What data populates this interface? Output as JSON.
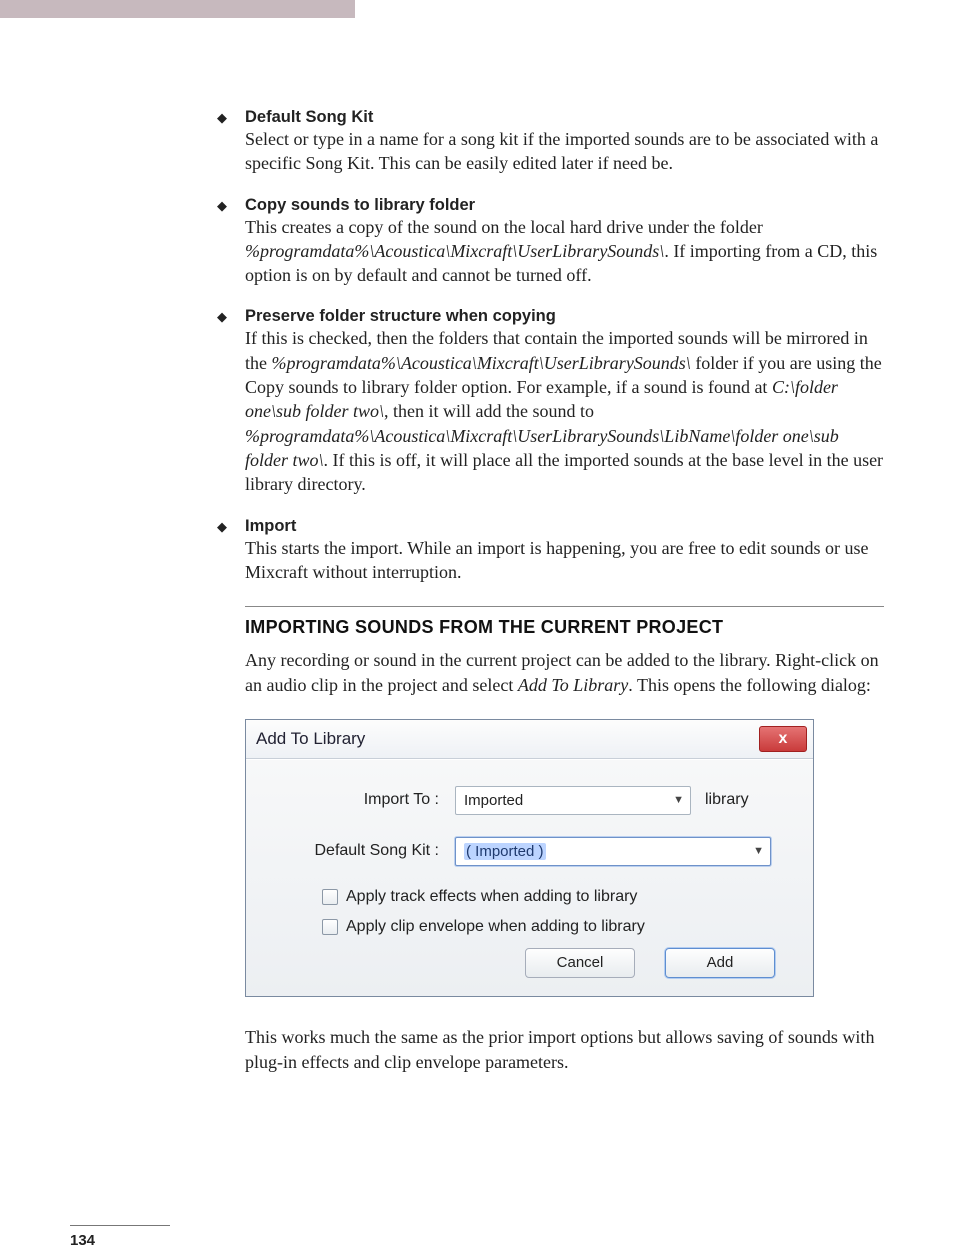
{
  "page_number": "134",
  "bullets": [
    {
      "title": "Default Song Kit",
      "body": "Select or type in a name for a song kit if the imported sounds are to be associated with a specific Song Kit. This can be easily edited later if need be."
    },
    {
      "title": "Copy sounds to library folder",
      "body_parts": {
        "p1": "This creates a copy of the sound on the local hard drive under the folder ",
        "i1": "%programdata%\\Acoustica\\Mixcraft\\UserLibrarySounds\\",
        "p2": ". If importing from a CD, this option is on by default and cannot be turned off."
      }
    },
    {
      "title": "Preserve folder structure when copying",
      "body_parts": {
        "p1": "If this is checked, then the folders that contain the imported sounds will be mirrored in the ",
        "i1": "%programdata%\\Acoustica\\Mixcraft\\UserLibrarySounds\\",
        "p2": " folder if you are using the Copy sounds to library folder option. For example, if a sound is found at ",
        "i2": "C:\\folder one\\sub folder two\\",
        "p3": ", then it will add the sound to ",
        "i3": "%programdata%\\Acoustica\\Mixcraft\\UserLibrarySounds\\LibName\\folder one\\sub folder two\\",
        "p4": ". If this is off, it will place all the imported sounds at the base level in the user library directory."
      }
    },
    {
      "title": "Import",
      "body": "This starts the import. While an import is happening, you are free to edit sounds or use Mixcraft without interruption."
    }
  ],
  "section": {
    "heading": "IMPORTING SOUNDS FROM THE CURRENT PROJECT",
    "body_parts": {
      "p1": "Any recording or sound in the current project can be added to the library. Right-click on an audio clip in the project and select ",
      "i1": "Add To Library",
      "p2": ". This opens the following dialog:"
    },
    "after": "This works much the same as the prior import options but allows saving of sounds with plug-in effects and clip envelope parameters."
  },
  "dialog": {
    "title": "Add To Library",
    "close": "x",
    "import_to_label": "Import To :",
    "import_to_value": "Imported",
    "import_to_suffix": "library",
    "song_kit_label": "Default Song Kit :",
    "song_kit_value": "( Imported )",
    "check1": "Apply track effects when adding to library",
    "check2": "Apply clip envelope when adding to library",
    "cancel": "Cancel",
    "add": "Add"
  },
  "caret": "▼"
}
